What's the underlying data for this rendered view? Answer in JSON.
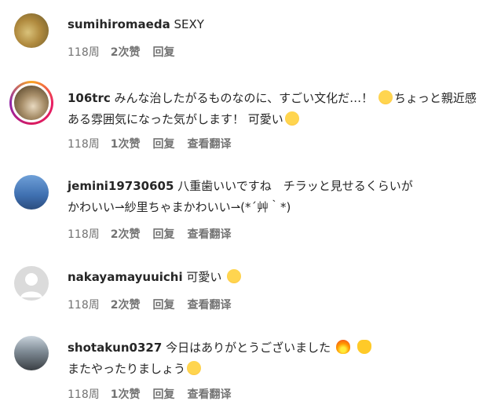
{
  "comments": [
    {
      "username": "sumihiromaeda",
      "text": " SEXY",
      "time": "118周",
      "likes": "2次赞",
      "reply": "回复",
      "translate": ""
    },
    {
      "username": "106trc",
      "text": " みんな治したがるものなのに、すごい文化だ…！",
      "text2": "ちょっと親近感ある雰囲気になった気がします！ 可愛い",
      "emoji1": "astonished-face-icon",
      "emoji2": "heart-eyes-icon",
      "time": "118周",
      "likes": "1次赞",
      "reply": "回复",
      "translate": "查看翻译"
    },
    {
      "username": "jemini19730605",
      "text": " 八重歯いいですね　チラッと見せるくらいが",
      "text2": "かわいい⇀紗里ちゃまかわいい⇀(*´艸｀*)",
      "time": "118周",
      "likes": "2次赞",
      "reply": "回复",
      "translate": "查看翻译"
    },
    {
      "username": "nakayamayuuichi",
      "text": " 可愛い",
      "emoji1": "tongue-face-icon",
      "time": "118周",
      "likes": "2次赞",
      "reply": "回复",
      "translate": "查看翻译"
    },
    {
      "username": "shotakun0327",
      "text": " 今日はありがとうございました",
      "text2": "またやったりましょう",
      "emoji1": "fire-icon",
      "emoji2": "raising-hands-icon",
      "emoji3": "grinning-face-icon",
      "time": "118周",
      "likes": "1次赞",
      "reply": "回复",
      "translate": "查看翻译"
    }
  ]
}
